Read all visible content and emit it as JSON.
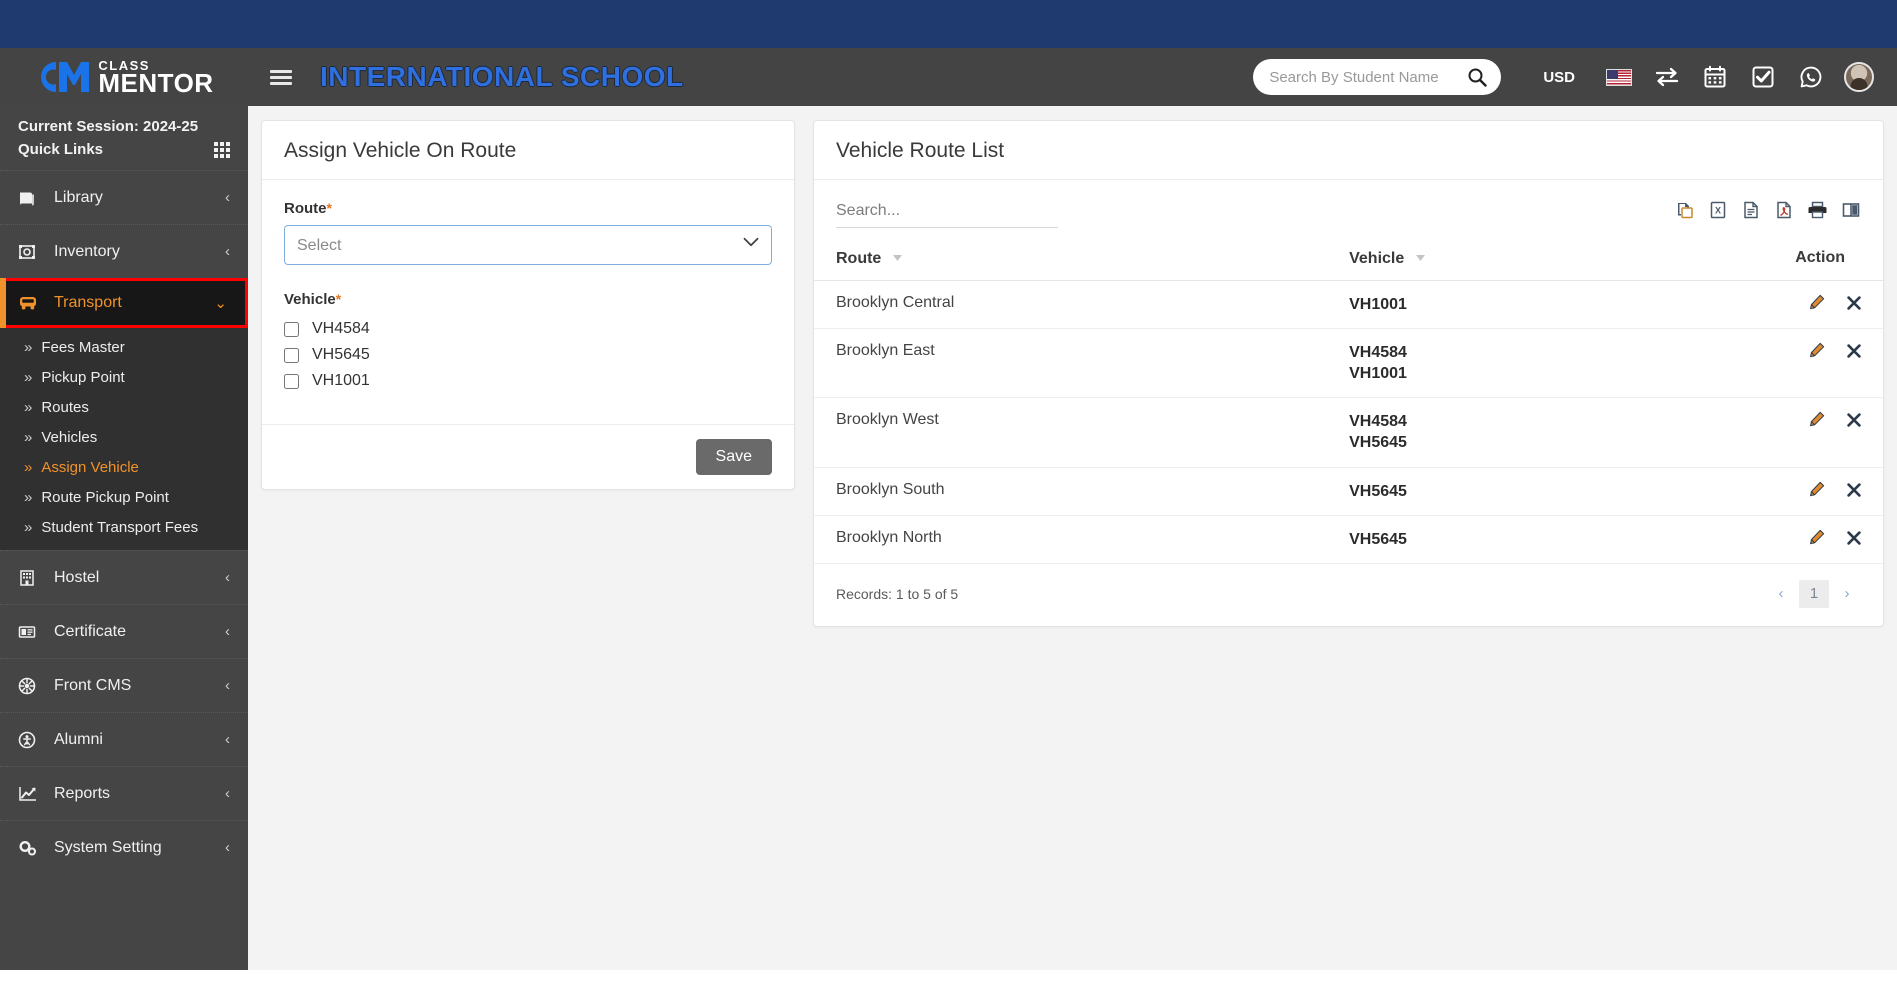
{
  "brand": {
    "top_text": "CLASS",
    "bottom_text": "MENTOR",
    "logo_icon": "cm-logo-icon"
  },
  "header": {
    "menu_icon": "hamburger-icon",
    "title": "INTERNATIONAL SCHOOL",
    "search": {
      "placeholder": "Search By Student Name",
      "value": "",
      "icon": "search-icon"
    },
    "currency": "USD",
    "icons": [
      {
        "name": "us-flag-icon"
      },
      {
        "name": "exchange-arrows-icon"
      },
      {
        "name": "calendar-icon"
      },
      {
        "name": "task-check-icon"
      },
      {
        "name": "whatsapp-icon"
      },
      {
        "name": "user-avatar"
      }
    ]
  },
  "sidebar": {
    "session_label": "Current Session: 2024-25",
    "quick_links_label": "Quick Links",
    "quick_links_icon": "grid-icon",
    "items": [
      {
        "label": "Library",
        "icon": "book-icon",
        "chevron": "‹",
        "active": false
      },
      {
        "label": "Inventory",
        "icon": "box-icon",
        "chevron": "‹",
        "active": false
      },
      {
        "label": "Transport",
        "icon": "bus-icon",
        "chevron": "⌄",
        "active": true
      },
      {
        "label": "Hostel",
        "icon": "building-icon",
        "chevron": "‹",
        "active": false
      },
      {
        "label": "Certificate",
        "icon": "certificate-icon",
        "chevron": "‹",
        "active": false
      },
      {
        "label": "Front CMS",
        "icon": "cms-gear-icon",
        "chevron": "‹",
        "active": false
      },
      {
        "label": "Alumni",
        "icon": "alumni-icon",
        "chevron": "‹",
        "active": false
      },
      {
        "label": "Reports",
        "icon": "chart-line-icon",
        "chevron": "‹",
        "active": false
      },
      {
        "label": "System Setting",
        "icon": "gears-icon",
        "chevron": "‹",
        "active": false
      }
    ],
    "transport_submenu": [
      {
        "label": "Fees Master",
        "active": false
      },
      {
        "label": "Pickup Point",
        "active": false
      },
      {
        "label": "Routes",
        "active": false
      },
      {
        "label": "Vehicles",
        "active": false
      },
      {
        "label": "Assign Vehicle",
        "active": true
      },
      {
        "label": "Route Pickup Point",
        "active": false
      },
      {
        "label": "Student Transport Fees",
        "active": false
      }
    ]
  },
  "form_panel": {
    "title": "Assign Vehicle On Route",
    "route_label": "Route",
    "required_mark": "*",
    "route_value": "Select",
    "route_options": [
      "Select"
    ],
    "vehicle_label": "Vehicle",
    "vehicles": [
      {
        "label": "VH4584",
        "checked": false
      },
      {
        "label": "VH5645",
        "checked": false
      },
      {
        "label": "VH1001",
        "checked": false
      }
    ],
    "save_label": "Save"
  },
  "list_panel": {
    "title": "Vehicle Route List",
    "search_placeholder": "Search...",
    "search_value": "",
    "export_icons": [
      {
        "name": "copy-icon"
      },
      {
        "name": "excel-export-icon"
      },
      {
        "name": "csv-export-icon"
      },
      {
        "name": "pdf-export-icon"
      },
      {
        "name": "print-icon"
      },
      {
        "name": "column-visibility-icon"
      }
    ],
    "columns": [
      "Route",
      "Vehicle",
      "Action"
    ],
    "rows": [
      {
        "route": "Brooklyn Central",
        "vehicles": [
          "VH1001"
        ]
      },
      {
        "route": "Brooklyn East",
        "vehicles": [
          "VH4584",
          "VH1001"
        ]
      },
      {
        "route": "Brooklyn West",
        "vehicles": [
          "VH4584",
          "VH5645"
        ]
      },
      {
        "route": "Brooklyn South",
        "vehicles": [
          "VH5645"
        ]
      },
      {
        "route": "Brooklyn North",
        "vehicles": [
          "VH5645"
        ]
      }
    ],
    "row_actions": [
      {
        "name": "edit-row-icon"
      },
      {
        "name": "delete-row-icon"
      }
    ],
    "records_text": "Records: 1 to 5 of 5",
    "pagination": {
      "prev": "‹",
      "pages": [
        "1"
      ],
      "next": "›",
      "current": "1"
    }
  },
  "colors": {
    "top_strip": "#1f3a6e",
    "header_bg": "#444444",
    "sidebar_bg": "#454545",
    "active_accent": "#f0922b",
    "active_border": "#fe0000",
    "title_blue": "#2f6fe0",
    "content_bg": "#f3f3f3",
    "save_btn": "#6a6a6a"
  }
}
